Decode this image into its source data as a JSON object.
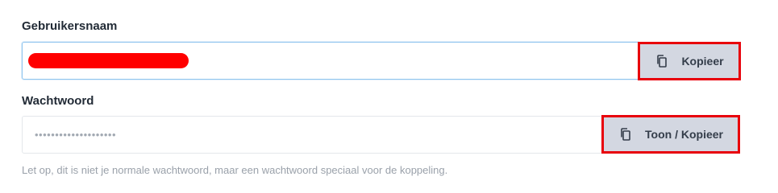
{
  "username": {
    "label": "Gebruikersnaam",
    "value": "",
    "redacted": true,
    "copy_button_label": "Kopieer",
    "copy_icon": "copy-icon"
  },
  "password": {
    "label": "Wachtwoord",
    "masked_value": "••••••••••••••••••••",
    "show_copy_button_label": "Toon / Kopieer",
    "copy_icon": "copy-icon"
  },
  "helper_text": "Let op, dit is niet je normale wachtwoord, maar een wachtwoord speciaal voor de koppeling.",
  "colors": {
    "button_background": "#d3d7e1",
    "highlight_border": "#e8000b",
    "redaction": "#ff0000",
    "focus_border": "#8fc4ee"
  }
}
